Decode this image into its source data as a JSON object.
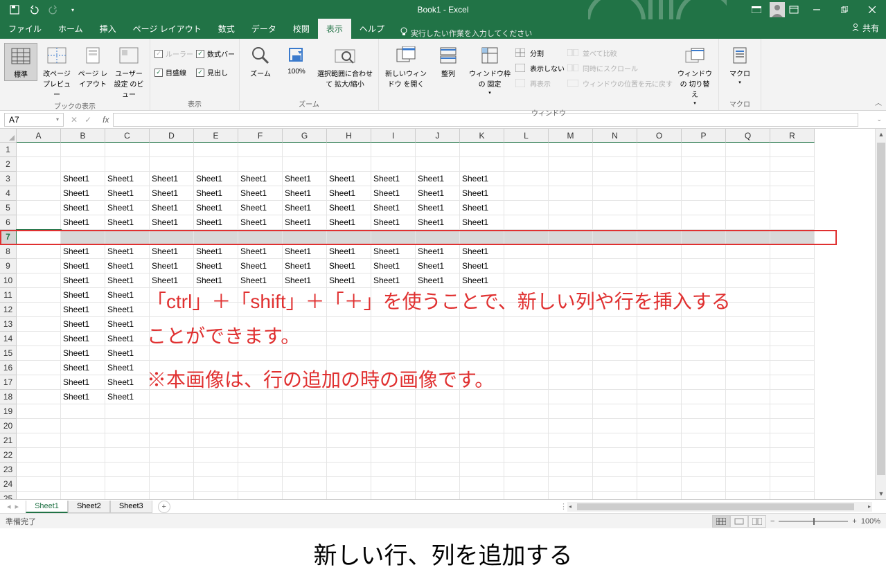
{
  "title": "Book1  -  Excel",
  "qat_icons": [
    "save",
    "undo",
    "redo",
    "customize"
  ],
  "tabs": [
    "ファイル",
    "ホーム",
    "挿入",
    "ページ レイアウト",
    "数式",
    "データ",
    "校閲",
    "表示",
    "ヘルプ"
  ],
  "active_tab": "表示",
  "tell_me": "実行したい作業を入力してください",
  "share": "共有",
  "ribbon": {
    "workbook_views": {
      "label": "ブックの表示",
      "items": [
        "標準",
        "改ページ プレビュー",
        "ページ レイアウト",
        "ユーザー設定 のビュー"
      ]
    },
    "show": {
      "label": "表示",
      "ruler": "ルーラー",
      "formula_bar": "数式バー",
      "gridlines": "目盛線",
      "headings": "見出し"
    },
    "zoom": {
      "label": "ズーム",
      "zoom_btn": "ズーム",
      "hundred": "100%",
      "fit": "選択範囲に合わせて 拡大/縮小"
    },
    "window": {
      "label": "ウィンドウ",
      "new_window": "新しいウィンドウ を開く",
      "arrange": "整列",
      "freeze": "ウィンドウ枠の 固定",
      "split": "分割",
      "hide": "表示しない",
      "unhide": "再表示",
      "side_by_side": "並べて比較",
      "sync_scroll": "同時にスクロール",
      "reset_pos": "ウィンドウの位置を元に戻す",
      "switch": "ウィンドウの 切り替え"
    },
    "macros": {
      "label": "マクロ",
      "btn": "マクロ"
    }
  },
  "namebox": "A7",
  "columns": [
    "A",
    "B",
    "C",
    "D",
    "E",
    "F",
    "G",
    "H",
    "I",
    "J",
    "K",
    "L",
    "M",
    "N",
    "O",
    "P",
    "Q",
    "R"
  ],
  "row_count": 25,
  "selected_row": 7,
  "cell_text": "Sheet1",
  "data_rows_full": [
    3,
    4,
    5,
    6,
    8,
    9,
    10
  ],
  "data_rows_two_col": [
    11,
    12,
    13,
    14,
    15,
    16,
    17,
    18
  ],
  "annotation_line1": "「ctrl」＋「shift」＋「＋」を使うことで、新しい列や行を挿入する",
  "annotation_line2": "ことができます。",
  "annotation_line3": "※本画像は、行の追加の時の画像です。",
  "sheets": [
    "Sheet1",
    "Sheet2",
    "Sheet3"
  ],
  "active_sheet": "Sheet1",
  "status_text": "準備完了",
  "zoom_pct": "100%",
  "caption": "新しい行、列を追加する"
}
